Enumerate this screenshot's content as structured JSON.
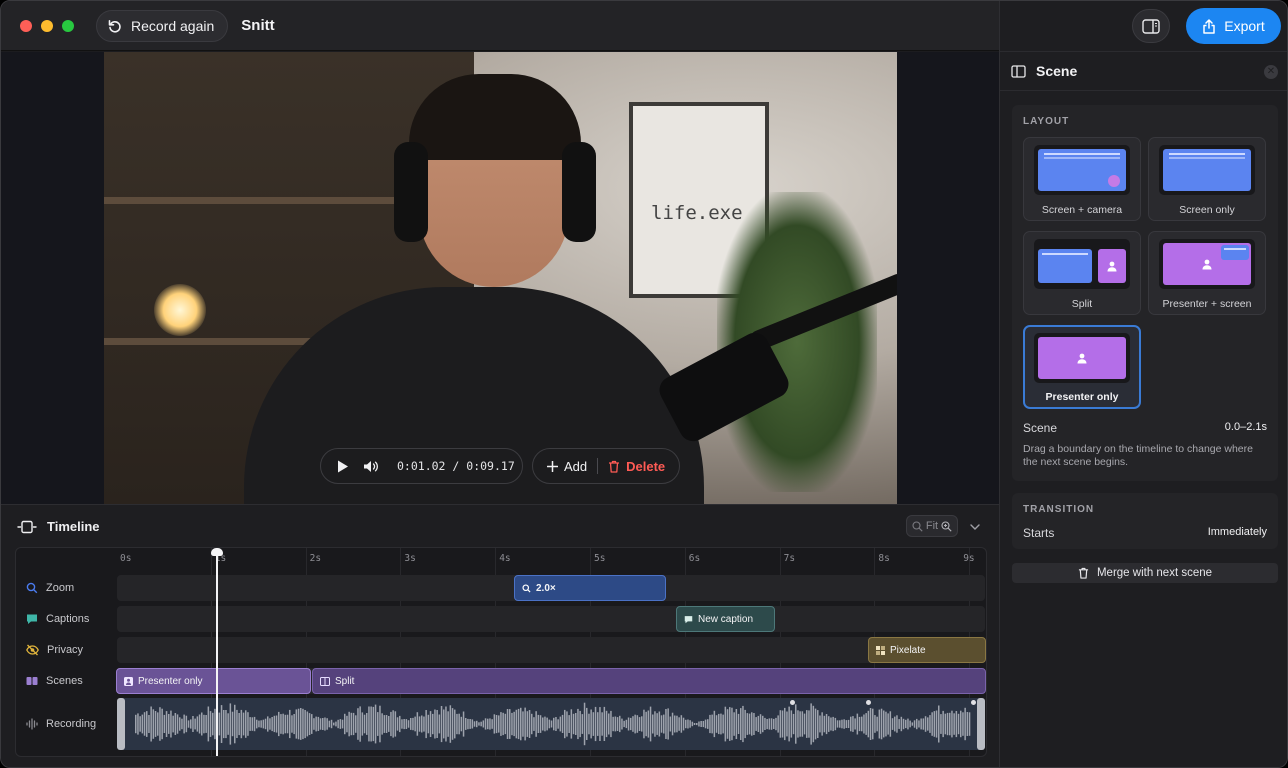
{
  "titlebar": {
    "record_again_label": "Record again",
    "app_title": "Snitt"
  },
  "player": {
    "time_current": "0:01.02",
    "time_separator": "/",
    "time_total": "0:09.17",
    "add_label": "Add",
    "delete_label": "Delete"
  },
  "video": {
    "poster_text": "life.exe"
  },
  "timeline": {
    "title": "Timeline",
    "fit_label": "Fit",
    "ticks": [
      "0s",
      "1s",
      "2s",
      "3s",
      "4s",
      "5s",
      "6s",
      "7s",
      "8s",
      "9s"
    ],
    "tracks": [
      {
        "label": "Zoom",
        "icon": "magnifier-icon",
        "color": "#4b7cf0"
      },
      {
        "label": "Captions",
        "icon": "caption-bubble-icon",
        "color": "#3fb6a8"
      },
      {
        "label": "Privacy",
        "icon": "eye-slash-icon",
        "color": "#e0b43c"
      },
      {
        "label": "Scenes",
        "icon": "scenes-icon",
        "color": "#9b7fd1"
      },
      {
        "label": "Recording",
        "icon": "waveform-icon",
        "color": "#8a8a90"
      }
    ],
    "clips": {
      "zoom": "2.0×",
      "caption": "New caption",
      "privacy": "Pixelate",
      "scene_1": "Presenter only",
      "scene_2": "Split"
    }
  },
  "sidebar": {
    "export_label": "Export",
    "panel_title": "Scene",
    "layout_section": "LAYOUT",
    "layouts": [
      {
        "label": "Screen + camera",
        "selected": false
      },
      {
        "label": "Screen only",
        "selected": false
      },
      {
        "label": "Split",
        "selected": false
      },
      {
        "label": "Presenter + screen",
        "selected": false
      },
      {
        "label": "Presenter only",
        "selected": true
      }
    ],
    "scene_label": "Scene",
    "scene_value": "0.0–2.1s",
    "scene_hint": "Drag a boundary on the timeline to change where the next scene begins.",
    "transition_section": "TRANSITION",
    "starts_label": "Starts",
    "starts_value": "Immediately",
    "merge_label": "Merge with next scene"
  },
  "colors": {
    "accent": "#1c86f2",
    "danger": "#ff5b55",
    "scene_purple": "#b46ee8",
    "screen_blue": "#5b84f0"
  }
}
